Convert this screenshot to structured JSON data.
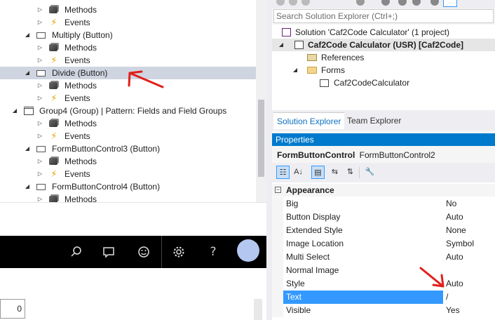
{
  "tree": {
    "rows": [
      {
        "label": "Methods",
        "icon": "methods-icon",
        "expander": "collapsed"
      },
      {
        "label": "Events",
        "icon": "events-icon",
        "expander": "collapsed"
      },
      {
        "label": "Multiply (Button)",
        "icon": "button-control-icon",
        "expander": "expanded"
      },
      {
        "label": "Methods",
        "icon": "methods-icon",
        "expander": "collapsed"
      },
      {
        "label": "Events",
        "icon": "events-icon",
        "expander": "collapsed"
      },
      {
        "label": "Divide (Button)",
        "icon": "button-control-icon",
        "expander": "expanded",
        "selected": true
      },
      {
        "label": "Methods",
        "icon": "methods-icon",
        "expander": "collapsed"
      },
      {
        "label": "Events",
        "icon": "events-icon",
        "expander": "collapsed"
      },
      {
        "label": "Group4 (Group) | Pattern: Fields and Field Groups",
        "icon": "group-icon",
        "expander": "expanded"
      },
      {
        "label": "Methods",
        "icon": "methods-icon",
        "expander": "collapsed"
      },
      {
        "label": "Events",
        "icon": "events-icon",
        "expander": "collapsed"
      },
      {
        "label": "FormButtonControl3 (Button)",
        "icon": "button-control-icon",
        "expander": "expanded"
      },
      {
        "label": "Methods",
        "icon": "methods-icon",
        "expander": "collapsed"
      },
      {
        "label": "Events",
        "icon": "events-icon",
        "expander": "collapsed"
      },
      {
        "label": "FormButtonControl4 (Button)",
        "icon": "button-control-icon",
        "expander": "expanded"
      },
      {
        "label": "Methods",
        "icon": "methods-icon",
        "expander": "collapsed"
      }
    ]
  },
  "app": {
    "toolbar_icons": [
      "search-icon",
      "comment-icon",
      "smiley-icon",
      "gear-icon",
      "help-icon"
    ],
    "field_value": "0"
  },
  "solution_explorer": {
    "search_placeholder": "Search Solution Explorer (Ctrl+;)",
    "solution": "Solution 'Caf2Code Calculator' (1 project)",
    "project": "Caf2Code Calculator (USR) [Caf2Code]",
    "references": "References",
    "forms": "Forms",
    "form_item": "Caf2CodeCalculator",
    "tabs": [
      "Solution Explorer",
      "Team Explorer"
    ]
  },
  "properties": {
    "title": "Properties",
    "object_type": "FormButtonControl",
    "object_name": "FormButtonControl2",
    "category": "Appearance",
    "rows": [
      {
        "name": "Big",
        "value": "No"
      },
      {
        "name": "Button Display",
        "value": "Auto"
      },
      {
        "name": "Extended Style",
        "value": "None"
      },
      {
        "name": "Image Location",
        "value": "Symbol"
      },
      {
        "name": "Multi Select",
        "value": "Auto"
      },
      {
        "name": "Normal Image",
        "value": ""
      },
      {
        "name": "Style",
        "value": "Auto"
      },
      {
        "name": "Text",
        "value": "/",
        "selected": true
      },
      {
        "name": "Visible",
        "value": "Yes"
      }
    ]
  },
  "colors": {
    "accent": "#007acc",
    "selection": "#3399ff",
    "annotation": "#e0201b"
  }
}
